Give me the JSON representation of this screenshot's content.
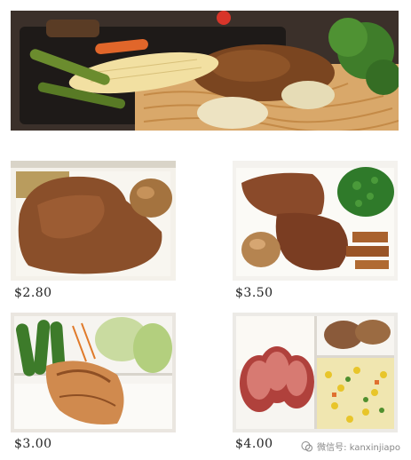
{
  "prices": [
    "$2.80",
    "$3.50",
    "$3.00",
    "$4.00"
  ],
  "watermark": "微信号: kanxinjiapo",
  "icons": {
    "watermark": "wechat-icon"
  }
}
